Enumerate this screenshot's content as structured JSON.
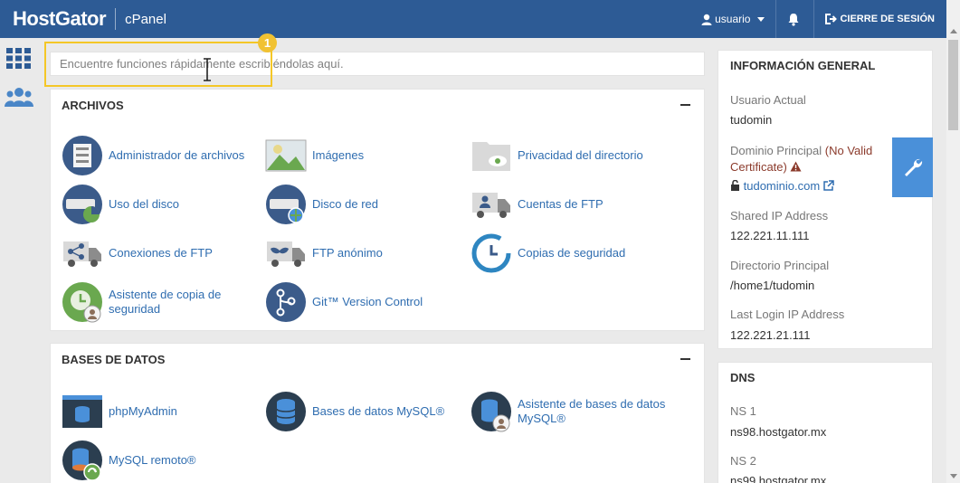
{
  "header": {
    "brand": "HostGator",
    "product": "cPanel",
    "user": "usuario",
    "logout": "CIERRE DE SESIÓN"
  },
  "search": {
    "placeholder": "Encuentre funciones rápidamente escribiéndolas aquí.",
    "step_badge": "1"
  },
  "files": {
    "title": "ARCHIVOS",
    "items": [
      "Administrador de archivos",
      "Imágenes",
      "Privacidad del directorio",
      "Uso del disco",
      "Disco de red",
      "Cuentas de FTP",
      "Conexiones de FTP",
      "FTP anónimo",
      "Copias de seguridad",
      "Asistente de copia de seguridad",
      "Git™ Version Control"
    ]
  },
  "databases": {
    "title": "BASES DE DATOS",
    "items": [
      "phpMyAdmin",
      "Bases de datos MySQL®",
      "Asistente de bases de datos MySQL®",
      "MySQL remoto®"
    ]
  },
  "general_info": {
    "title": "INFORMACIÓN GENERAL",
    "current_user_label": "Usuario Actual",
    "current_user": "tudomin",
    "main_domain_label": "Dominio Principal",
    "cert_warning": "(No Valid Certificate)",
    "main_domain": "tudominio.com",
    "shared_ip_label": "Shared IP Address",
    "shared_ip": "122.221.11.111",
    "home_dir_label": "Directorio Principal",
    "home_dir": "/home1/tudomin",
    "last_login_label": "Last Login IP Address",
    "last_login": "122.221.21.111"
  },
  "dns": {
    "title": "DNS",
    "ns1_label": "NS 1",
    "ns1": "ns98.hostgator.mx",
    "ns2_label": "NS 2",
    "ns2": "ns99.hostgator.mx"
  },
  "colors": {
    "topbar": "#2d5b95",
    "link": "#2f6db0",
    "highlight": "#f4c727",
    "wrench_tab": "#4a90d9"
  }
}
